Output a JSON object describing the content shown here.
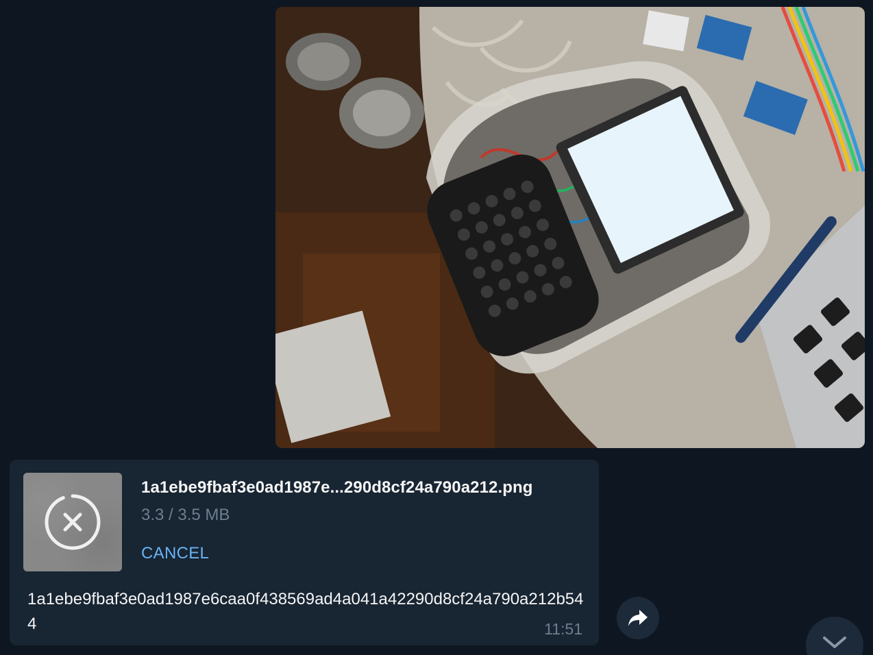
{
  "photo": {
    "alt_icon": "photo-icon"
  },
  "file_message": {
    "file_name": "1a1ebe9fbaf3e0ad1987e...290d8cf24a790a212.png",
    "size_progress": "3.3 / 3.5 MB",
    "download_progress_fraction": 0.94,
    "cancel_label": "CANCEL",
    "caption": "1a1ebe9fbaf3e0ad1987e6caa0f438569ad4a041a42290d8cf24a790a212b544",
    "time": "11:51",
    "cancel_icon": "close-icon"
  },
  "buttons": {
    "forward_icon": "forward-icon",
    "scroll_down_icon": "chevron-down-icon"
  },
  "colors": {
    "background": "#0e1621",
    "bubble": "#182533",
    "accent": "#6ab3f3",
    "muted_text": "#6d7f8f"
  }
}
